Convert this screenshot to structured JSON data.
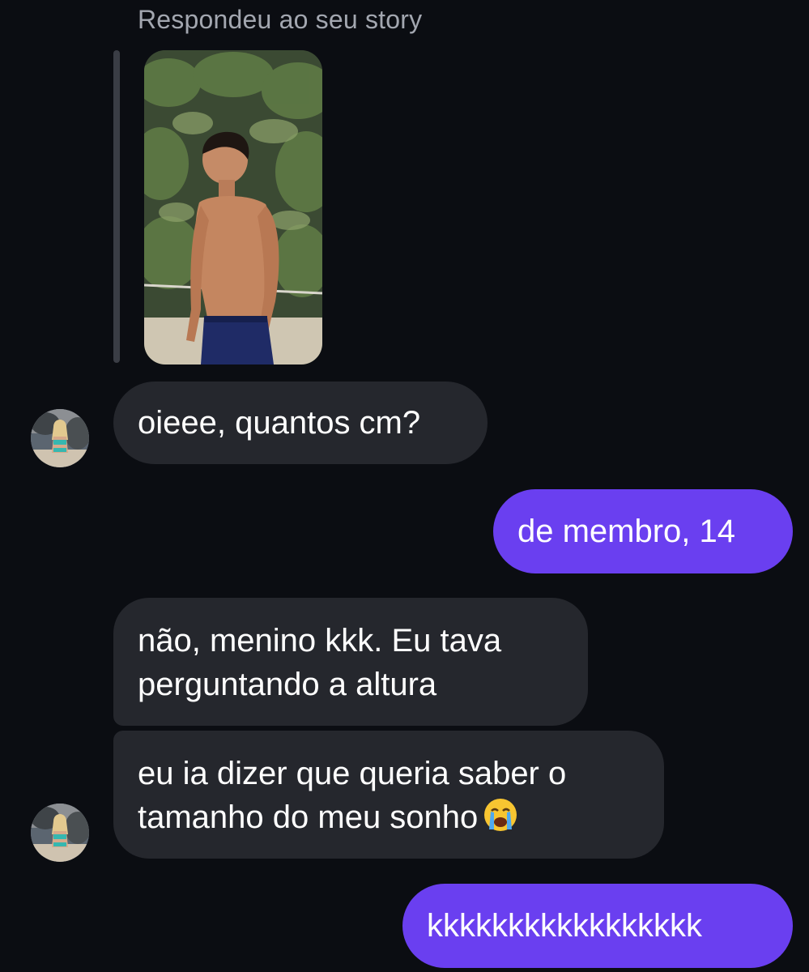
{
  "reply_header": "Respondeu ao seu story",
  "story": {
    "image_icon": "story-photo",
    "accent_color": "#3a3d45"
  },
  "contact": {
    "avatar_icon": "contact-avatar"
  },
  "messages": [
    {
      "side": "incoming",
      "lines": [
        "oieee, quantos cm?"
      ]
    },
    {
      "side": "outgoing",
      "lines": [
        "de membro, 14"
      ]
    },
    {
      "side": "incoming",
      "lines": [
        "não, menino kkk. Eu tava",
        "perguntando a altura"
      ]
    },
    {
      "side": "incoming",
      "lines": [
        "eu ia dizer que queria saber o",
        "tamanho do meu sonho"
      ],
      "emoji": "😭"
    },
    {
      "side": "outgoing",
      "lines": [
        "kkkkkkkkkkkkkkkkk"
      ]
    }
  ],
  "colors": {
    "background": "#0b0d12",
    "incoming_bubble": "#25272d",
    "outgoing_bubble": "#6a3ff0",
    "meta_text": "#a3a7b0"
  }
}
